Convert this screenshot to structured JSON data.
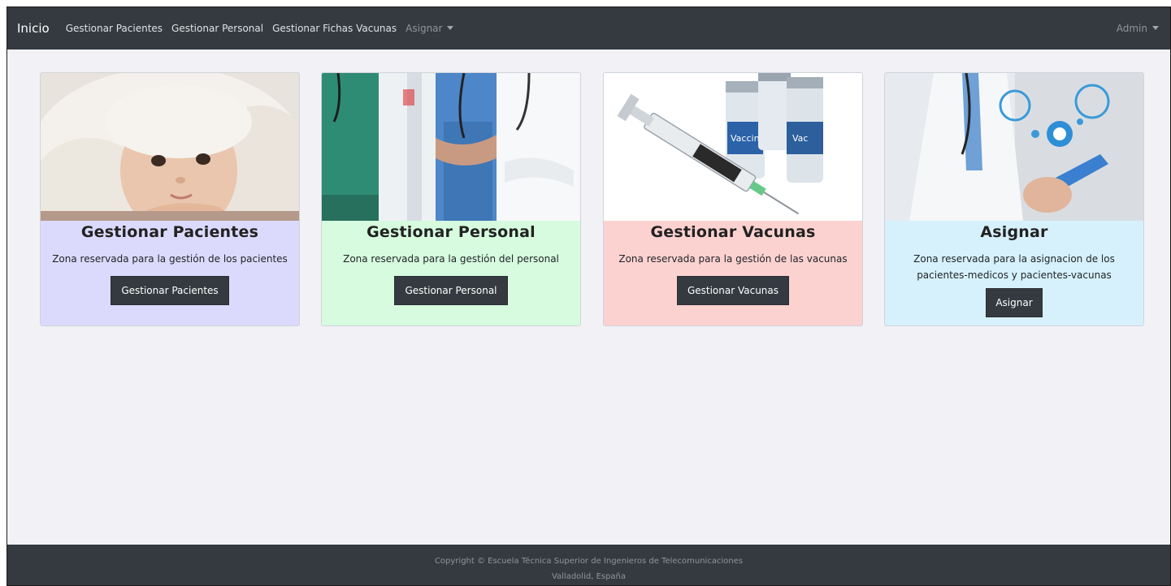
{
  "navbar": {
    "brand": "Inicio",
    "links": [
      "Gestionar Pacientes",
      "Gestionar Personal",
      "Gestionar Fichas Vacunas"
    ],
    "dropdown": "Asignar",
    "user": "Admin"
  },
  "cards": [
    {
      "title": "Gestionar Pacientes",
      "text": "Zona reservada para la gestión de los pacientes",
      "button": "Gestionar Pacientes",
      "bg": "#dcdafc",
      "image": "baby-photo"
    },
    {
      "title": "Gestionar Personal",
      "text": "Zona reservada para la gestión del personal",
      "button": "Gestionar Personal",
      "bg": "#d6fbdf",
      "image": "medical-staff-photo"
    },
    {
      "title": "Gestionar Vacunas",
      "text": "Zona reservada para la gestión de las vacunas",
      "button": "Gestionar Vacunas",
      "bg": "#fcd2d1",
      "image": "syringe-vaccine-photo",
      "vial_labels": [
        "Vaccine",
        "Vac"
      ]
    },
    {
      "title": "Asignar",
      "text": "Zona reservada para la asignacion de los pacientes-medicos y pacientes-vacunas",
      "button": "Asignar",
      "bg": "#d6f1fc",
      "image": "doctor-tablet-photo"
    }
  ],
  "footer": {
    "line1": "Copyright © Escuela Técnica Superior de Ingenieros de Telecomunicaciones",
    "line2": "Valladolid, España"
  },
  "colors": {
    "navbar": "#343a40",
    "page_bg": "#f2f1f6",
    "button": "#343a40"
  }
}
